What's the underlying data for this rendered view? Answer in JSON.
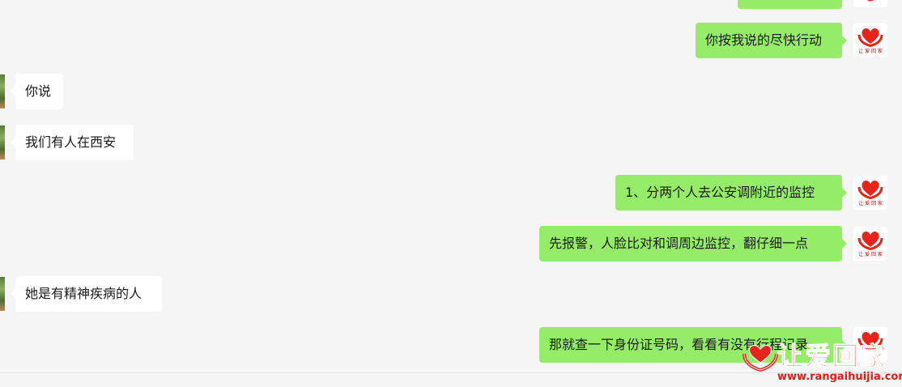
{
  "conversation": {
    "messages": [
      {
        "side": "out",
        "text": ""
      },
      {
        "side": "out",
        "text": "你按我说的尽快行动"
      },
      {
        "side": "in",
        "text": "你说"
      },
      {
        "side": "in",
        "text": "我们有人在西安"
      },
      {
        "side": "out",
        "text": "1、分两个人去公安调附近的监控"
      },
      {
        "side": "out",
        "text": "先报警，人脸比对和调周边监控，翻仔细一点"
      },
      {
        "side": "in",
        "text": "她是有精神疾病的人"
      },
      {
        "side": "out",
        "text": "那就查一下身份证号码，看看有没有行程记录"
      }
    ]
  },
  "avatar_self": {
    "icon": "heart-hands-logo-icon",
    "caption": "让 爱 回 家"
  },
  "watermark": {
    "title": "让爱回家",
    "url": "www.rangaihuijia.com"
  },
  "colors": {
    "background": "#f5f5f5",
    "outgoing_bubble": "#95ec69",
    "incoming_bubble": "#ffffff",
    "brand_red": "#e8231a"
  }
}
